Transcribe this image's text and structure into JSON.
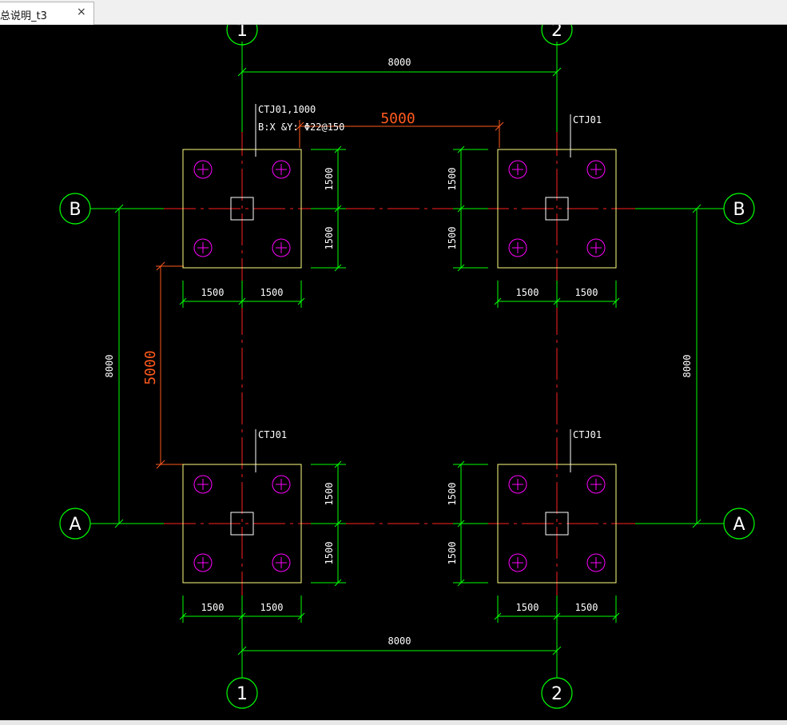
{
  "tab": {
    "title": "总说明_t3",
    "close_glyph": "×",
    "close_icon": "close-icon"
  },
  "colors": {
    "background": "#000000",
    "axis_line": "#ff2020",
    "dimension": "#00ff00",
    "footing_outline": "#ffff80",
    "pile": "#ff00ff",
    "column": "#ffffff",
    "label": "#ffffff",
    "annotation": "#ff5a1e"
  },
  "grid_labels": {
    "col_1": "1",
    "col_2": "2",
    "row_a": "A",
    "row_b": "B"
  },
  "dimensions": {
    "span_x": "8000",
    "span_y": "8000",
    "half_footing": "1500",
    "offset_annotation": "5000"
  },
  "footings": {
    "tag_first": "CTJ01,1000",
    "reinforcement": "B:X  &Y: Φ22@150",
    "tag": "CTJ01"
  }
}
